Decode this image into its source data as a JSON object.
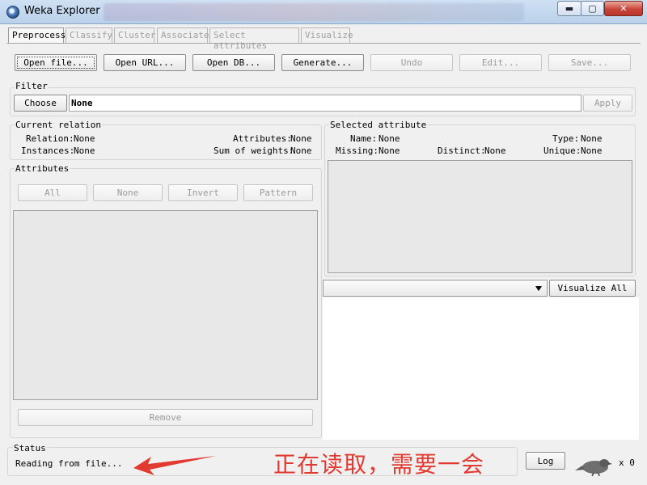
{
  "window": {
    "title": "Weka Explorer",
    "minimize_icon": "minimize-icon",
    "maximize_icon": "maximize-icon",
    "close_icon": "close-icon",
    "min_glyph": "▬",
    "max_glyph": "▢",
    "close_glyph": "✕"
  },
  "tabs": [
    {
      "label": "Preprocess",
      "active": true
    },
    {
      "label": "Classify",
      "active": false
    },
    {
      "label": "Cluster",
      "active": false
    },
    {
      "label": "Associate",
      "active": false
    },
    {
      "label": "Select attributes",
      "active": false
    },
    {
      "label": "Visualize",
      "active": false
    }
  ],
  "toolbar": {
    "open_file": "Open file...",
    "open_url": "Open URL...",
    "open_db": "Open DB...",
    "generate": "Generate...",
    "undo": "Undo",
    "edit": "Edit...",
    "save": "Save..."
  },
  "filter": {
    "title": "Filter",
    "choose": "Choose",
    "value": "None",
    "apply": "Apply"
  },
  "current_relation": {
    "title": "Current relation",
    "relation_label": "Relation:",
    "relation_value": "None",
    "instances_label": "Instances:",
    "instances_value": "None",
    "attributes_label": "Attributes:",
    "attributes_value": "None",
    "sum_weights_label": "Sum of weights:",
    "sum_weights_value": "None"
  },
  "attributes": {
    "title": "Attributes",
    "all": "All",
    "none": "None",
    "invert": "Invert",
    "pattern": "Pattern",
    "remove": "Remove"
  },
  "selected_attribute": {
    "title": "Selected attribute",
    "name_label": "Name:",
    "name_value": "None",
    "type_label": "Type:",
    "type_value": "None",
    "missing_label": "Missing:",
    "missing_value": "None",
    "distinct_label": "Distinct:",
    "distinct_value": "None",
    "unique_label": "Unique:",
    "unique_value": "None"
  },
  "visualize_all": "Visualize All",
  "status": {
    "title": "Status",
    "text": "Reading from file...",
    "annotation": "正在读取，需要一会",
    "log": "Log",
    "count": "x 0"
  },
  "colors": {
    "annotation_red": "#e23a31",
    "window_bg": "#f0f0f0"
  }
}
